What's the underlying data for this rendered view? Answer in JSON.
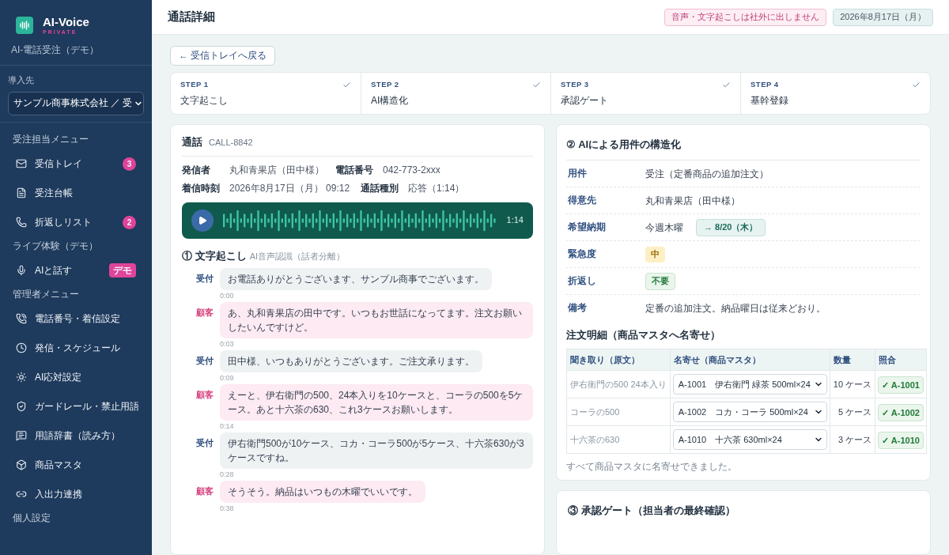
{
  "sidebar": {
    "brand": "AI-Voice",
    "brand_sub": "PRIVATE",
    "subtitle": "AI-電話受注（デモ）",
    "tenant_label": "導入先",
    "tenant_value": "サンプル商事株式会社 ／ 受",
    "sections": [
      {
        "title": "受注担当メニュー",
        "items": [
          {
            "kind": "count",
            "label": "受信トレイ",
            "badge": "3"
          },
          {
            "kind": "plain",
            "label": "受注台帳"
          },
          {
            "kind": "count",
            "label": "折返しリスト",
            "badge": "2"
          }
        ]
      },
      {
        "title": "ライブ体験（デモ）",
        "items": [
          {
            "kind": "tag",
            "label": "AIと話す",
            "badge": "デモ"
          }
        ]
      },
      {
        "title": "管理者メニュー",
        "items": [
          {
            "kind": "plain",
            "label": "電話番号・着信設定"
          },
          {
            "kind": "plain",
            "label": "発信・スケジュール"
          },
          {
            "kind": "plain",
            "label": "AI応対設定"
          },
          {
            "kind": "plain",
            "label": "ガードレール・禁止用語"
          },
          {
            "kind": "plain",
            "label": "用語辞書（読み方）"
          },
          {
            "kind": "plain",
            "label": "商品マスタ"
          },
          {
            "kind": "plain",
            "label": "入出力連携"
          }
        ]
      },
      {
        "title": "個人設定"
      }
    ]
  },
  "header": {
    "title": "通話詳細",
    "notice": "音声・文字起こしは社外に出しません",
    "date": "2026年8月17日（月）"
  },
  "back_button": "← 受信トレイへ戻る",
  "steps": [
    {
      "step": "STEP 1",
      "label": "文字起こし",
      "done": true
    },
    {
      "step": "STEP 2",
      "label": "AI構造化",
      "done": true
    },
    {
      "step": "STEP 3",
      "label": "承認ゲート",
      "done": true
    },
    {
      "step": "STEP 4",
      "label": "基幹登録",
      "done": true
    }
  ],
  "call": {
    "title": "通話",
    "id": "CALL-8842",
    "info": [
      [
        {
          "label": "発信者",
          "value": "丸和青果店（田中様）"
        },
        {
          "label": "電話番号",
          "value": "042-773-2xxx"
        }
      ],
      [
        {
          "label": "着信時刻",
          "value": "2026年8月17日（月） 09:12"
        },
        {
          "label": "通話種別",
          "value": "応答（1:14）"
        }
      ]
    ],
    "audio_duration": "1:14",
    "transcript_title": "① 文字起こし",
    "transcript_sub": "AI音声認識（話者分離）",
    "messages": [
      {
        "kind": "staff",
        "speaker": "受付",
        "text": "お電話ありがとうございます、サンプル商事でございます。",
        "time": "0:00"
      },
      {
        "kind": "customer",
        "speaker": "顧客",
        "text": "あ、丸和青果店の田中です。いつもお世話になってます。注文お願いしたいんですけど。",
        "time": "0:03"
      },
      {
        "kind": "staff",
        "speaker": "受付",
        "text": "田中様、いつもありがとうございます。ご注文承ります。",
        "time": "0:09"
      },
      {
        "kind": "customer",
        "speaker": "顧客",
        "text": "えーと、伊右衛門の500、24本入りを10ケースと、コーラの500を5ケース。あと十六茶の630、これ3ケースお願いします。",
        "time": "0:14"
      },
      {
        "kind": "staff",
        "speaker": "受付",
        "text": "伊右衛門500が10ケース、コカ・コーラ500が5ケース、十六茶630が3ケースですね。",
        "time": "0:28"
      },
      {
        "kind": "customer",
        "speaker": "顧客",
        "text": "そうそう。納品はいつもの木曜でいいです。",
        "time": "0:38"
      }
    ]
  },
  "structure": {
    "title": "② AIによる用件の構造化",
    "fields": [
      {
        "kind": "text",
        "label": "用件",
        "value": "受注（定番商品の追加注文）"
      },
      {
        "kind": "text",
        "label": "得意先",
        "value": "丸和青果店（田中様）"
      },
      {
        "kind": "date",
        "label": "希望納期",
        "value": "今週木曜",
        "chip": "→ 8/20（木）"
      },
      {
        "kind": "urgency",
        "label": "緊急度",
        "chip": "中"
      },
      {
        "kind": "status",
        "label": "折返し",
        "chip": "不要"
      },
      {
        "kind": "text",
        "label": "備考",
        "value": "定番の追加注文。納品曜日は従来どおり。"
      }
    ],
    "order_title": "注文明細（商品マスタへ名寄せ）",
    "columns": [
      "聞き取り（原文）",
      "名寄せ（商品マスタ）",
      "数量",
      "照合"
    ],
    "rows": [
      {
        "heard": "伊右衛門の500 24本入り",
        "match": "A-1001　伊右衛門 緑茶 500ml×24",
        "qty": "10 ケース",
        "check": "✓ A-1001"
      },
      {
        "heard": "コーラの500",
        "match": "A-1002　コカ・コーラ 500ml×24",
        "qty": "5 ケース",
        "check": "✓ A-1002"
      },
      {
        "heard": "十六茶の630",
        "match": "A-1010　十六茶 630ml×24",
        "qty": "3 ケース",
        "check": "✓ A-1010"
      }
    ],
    "note": "すべて商品マスタに名寄せできました。"
  },
  "approval": {
    "title": "③ 承認ゲート（担当者の最終確認）"
  }
}
